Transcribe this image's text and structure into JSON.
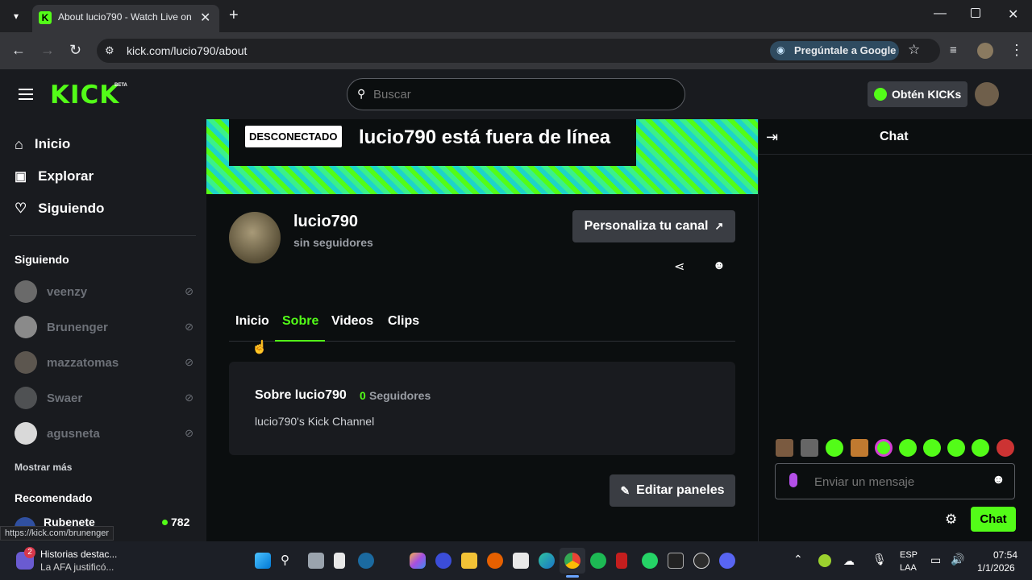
{
  "browser": {
    "tab_title": "About lucio790 - Watch Live on",
    "url": "kick.com/lucio790/about",
    "ask_google": "Pregúntale a Google",
    "status_url": "https://kick.com/brunenger"
  },
  "header": {
    "logo_text": "KICK",
    "beta": "BETA",
    "search_placeholder": "Buscar",
    "get_kicks": "Obtén KICKs"
  },
  "sidebar": {
    "nav": [
      {
        "label": "Inicio",
        "icon": "home-icon"
      },
      {
        "label": "Explorar",
        "icon": "explore-icon"
      },
      {
        "label": "Siguiendo",
        "icon": "heart-icon"
      }
    ],
    "following_title": "Siguiendo",
    "following": [
      {
        "name": "veenzy"
      },
      {
        "name": "Brunenger"
      },
      {
        "name": "mazzatomas"
      },
      {
        "name": "Swaer"
      },
      {
        "name": "agusneta"
      }
    ],
    "show_more": "Mostrar más",
    "recommended_title": "Recomendado",
    "recommended": [
      {
        "name": "Rubenete",
        "viewers": "782"
      }
    ]
  },
  "channel": {
    "offline_badge": "DESCONECTADO",
    "offline_text": "lucio790 está fuera de línea",
    "name": "lucio790",
    "followers": "sin seguidores",
    "customize": "Personaliza tu canal",
    "tabs": [
      "Inicio",
      "Sobre",
      "Videos",
      "Clips"
    ],
    "active_tab": "Sobre",
    "about_title": "Sobre lucio790",
    "about_count": "0",
    "about_count_label": "Seguidores",
    "about_desc": "lucio790's Kick Channel",
    "edit_panels": "Editar paneles"
  },
  "chat": {
    "title": "Chat",
    "input_placeholder": "Enviar un mensaje",
    "send_label": "Chat"
  },
  "taskbar": {
    "news_title": "Historias destac...",
    "news_sub": "La AFA justificó...",
    "news_badge": "2",
    "lang1": "ESP",
    "lang2": "LAA",
    "time": "07:54",
    "date": "1/1/2026"
  },
  "colors": {
    "accent": "#53fc18",
    "background": "#0b0e0f",
    "panel": "#191b1f"
  }
}
